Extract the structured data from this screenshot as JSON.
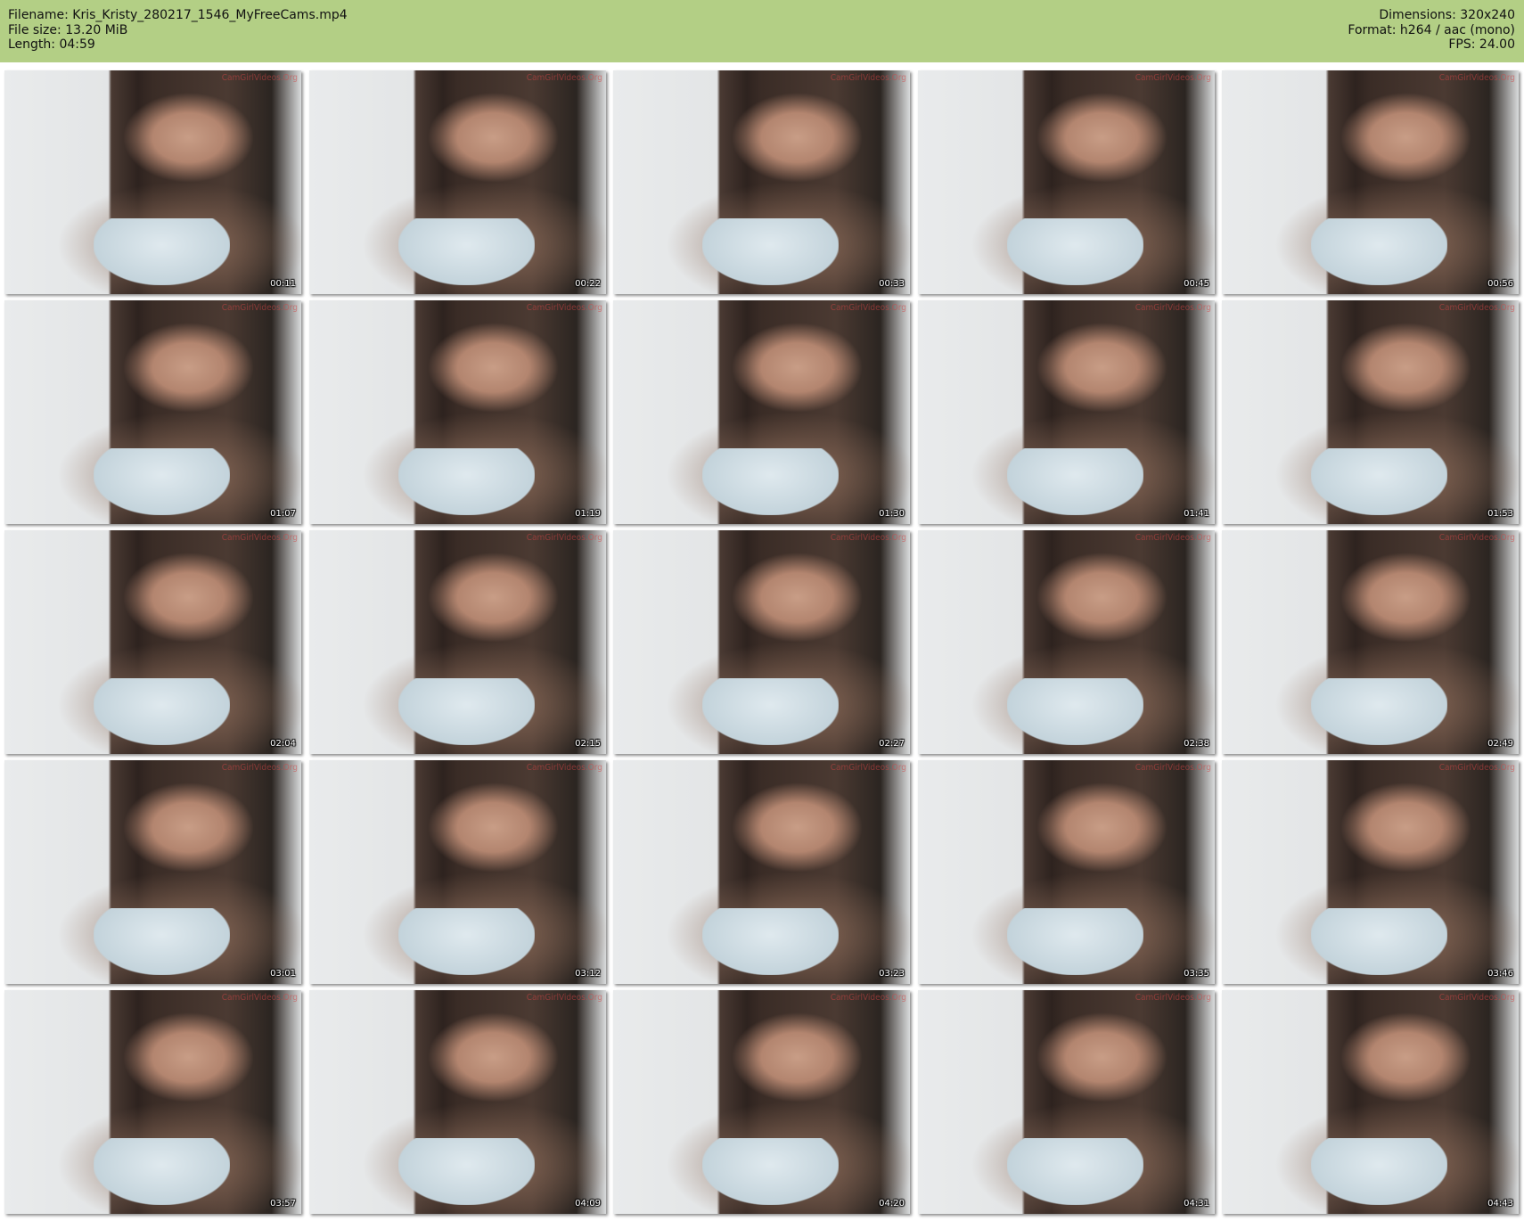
{
  "header": {
    "filename_line": "Filename: Kris_Kristy_280217_1546_MyFreeCams.mp4",
    "filesize_line": "File size: 13.20 MiB",
    "length_line": "Length: 04:59",
    "dimensions_line": "Dimensions: 320x240",
    "format_line": "Format: h264 / aac (mono)",
    "fps_line": "FPS: 24.00",
    "background_color": "#b3cf85"
  },
  "thumbnails": [
    {
      "timestamp": "00:11",
      "watermark": "CamGirlVideos.Org"
    },
    {
      "timestamp": "00:22",
      "watermark": "CamGirlVideos.Org"
    },
    {
      "timestamp": "00:33",
      "watermark": "CamGirlVideos.Org"
    },
    {
      "timestamp": "00:45",
      "watermark": "CamGirlVideos.Org"
    },
    {
      "timestamp": "00:56",
      "watermark": "CamGirlVideos.Org"
    },
    {
      "timestamp": "01:07",
      "watermark": "CamGirlVideos.Org"
    },
    {
      "timestamp": "01:19",
      "watermark": "CamGirlVideos.Org"
    },
    {
      "timestamp": "01:30",
      "watermark": "CamGirlVideos.Org"
    },
    {
      "timestamp": "01:41",
      "watermark": "CamGirlVideos.Org"
    },
    {
      "timestamp": "01:53",
      "watermark": "CamGirlVideos.Org"
    },
    {
      "timestamp": "02:04",
      "watermark": "CamGirlVideos.Org"
    },
    {
      "timestamp": "02:15",
      "watermark": "CamGirlVideos.Org"
    },
    {
      "timestamp": "02:27",
      "watermark": "CamGirlVideos.Org"
    },
    {
      "timestamp": "02:38",
      "watermark": "CamGirlVideos.Org"
    },
    {
      "timestamp": "02:49",
      "watermark": "CamGirlVideos.Org"
    },
    {
      "timestamp": "03:01",
      "watermark": "CamGirlVideos.Org"
    },
    {
      "timestamp": "03:12",
      "watermark": "CamGirlVideos.Org"
    },
    {
      "timestamp": "03:23",
      "watermark": "CamGirlVideos.Org"
    },
    {
      "timestamp": "03:35",
      "watermark": "CamGirlVideos.Org"
    },
    {
      "timestamp": "03:46",
      "watermark": "CamGirlVideos.Org"
    },
    {
      "timestamp": "03:57",
      "watermark": "CamGirlVideos.Org"
    },
    {
      "timestamp": "04:09",
      "watermark": "CamGirlVideos.Org"
    },
    {
      "timestamp": "04:20",
      "watermark": "CamGirlVideos.Org"
    },
    {
      "timestamp": "04:31",
      "watermark": "CamGirlVideos.Org"
    },
    {
      "timestamp": "04:43",
      "watermark": "CamGirlVideos.Org"
    }
  ]
}
